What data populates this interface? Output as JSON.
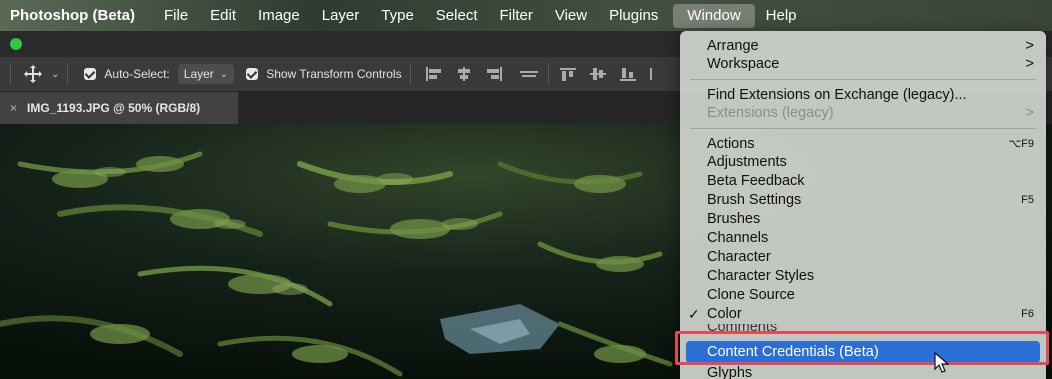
{
  "menubar": {
    "app_name": "Photoshop (Beta)",
    "items": [
      "File",
      "Edit",
      "Image",
      "Layer",
      "Type",
      "Select",
      "Filter",
      "View",
      "Plugins",
      "Window",
      "Help"
    ],
    "active_item": "Window"
  },
  "options_bar": {
    "auto_select_label": "Auto-Select:",
    "auto_select_value": "Layer",
    "show_transform_label": "Show Transform Controls"
  },
  "document_tab": {
    "close_glyph": "×",
    "title": "IMG_1193.JPG @ 50% (RGB/8)"
  },
  "window_menu": {
    "items": [
      {
        "label": "Arrange",
        "submenu": ">"
      },
      {
        "label": "Workspace",
        "submenu": ">"
      },
      {
        "label": "Find Extensions on Exchange (legacy)..."
      },
      {
        "label": "Extensions (legacy)",
        "submenu": ">",
        "disabled": true
      },
      {
        "label": "Actions",
        "shortcut": "⌥F9"
      },
      {
        "label": "Adjustments"
      },
      {
        "label": "Beta Feedback"
      },
      {
        "label": "Brush Settings",
        "shortcut": "F5"
      },
      {
        "label": "Brushes"
      },
      {
        "label": "Channels"
      },
      {
        "label": "Character"
      },
      {
        "label": "Character Styles"
      },
      {
        "label": "Clone Source"
      },
      {
        "label": "Color",
        "shortcut": "F6",
        "checked": true,
        "check_glyph": "✓"
      },
      {
        "label": "Comments"
      },
      {
        "label": "Content Credentials (Beta)",
        "highlighted": true
      },
      {
        "label": "Glyphs"
      }
    ]
  },
  "colors": {
    "highlight": "#2b6fd4",
    "annotation": "#e24a57",
    "traffic_green": "#2dc840"
  },
  "icons": [
    "move-tool-icon",
    "checkbox-icon",
    "chevron-down-icon",
    "align-icon",
    "submenu-chevron-icon",
    "cursor-icon"
  ]
}
